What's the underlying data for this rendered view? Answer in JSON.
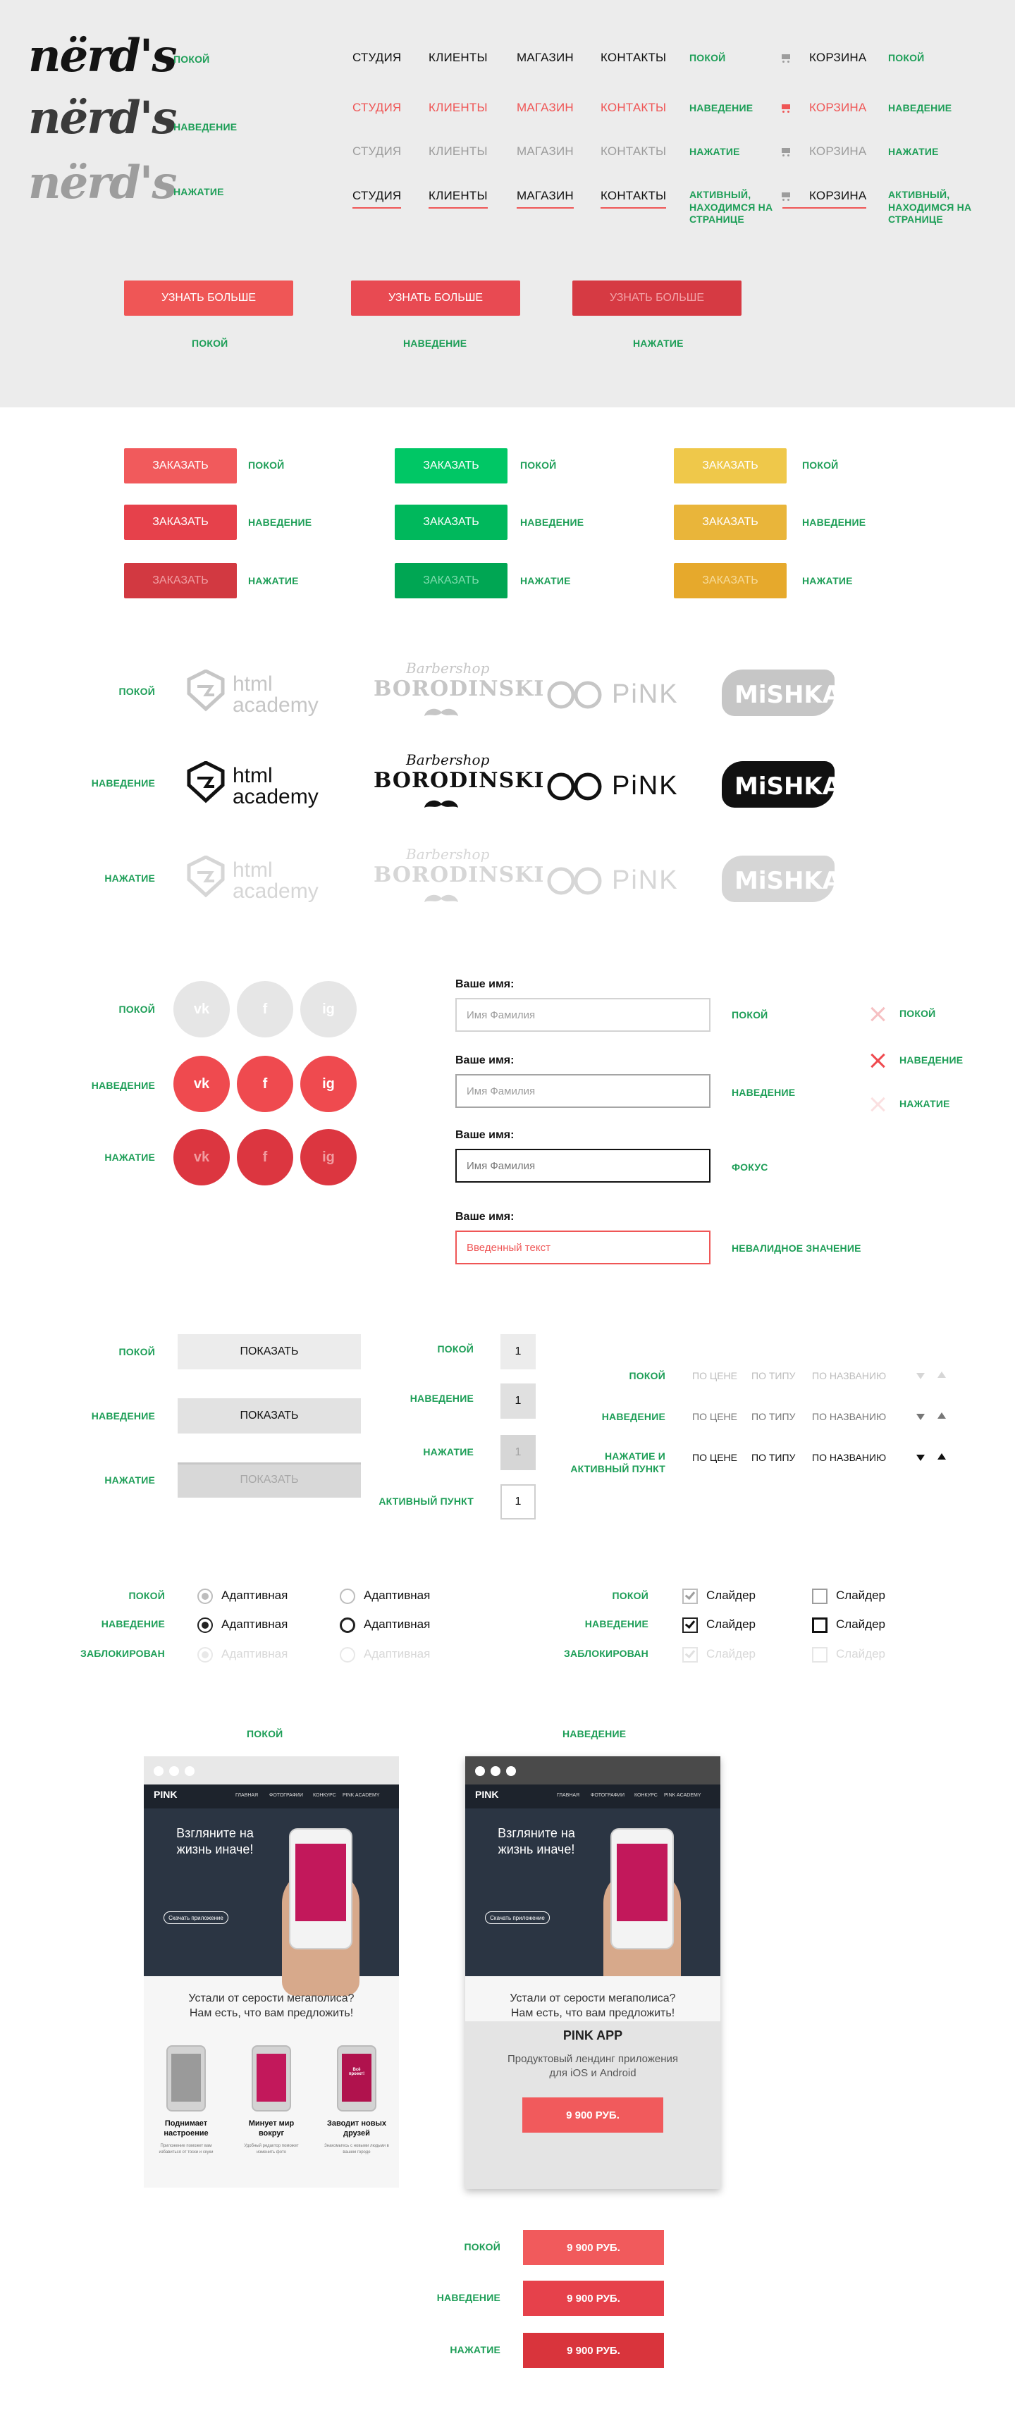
{
  "states": {
    "idle": "ПОКОЙ",
    "hover": "НАВЕДЕНИЕ",
    "press": "НАЖАТИЕ",
    "focus": "ФОКУС",
    "invalid": "НЕВАЛИДНОЕ ЗНАЧЕНИЕ",
    "active_page": "АКТИВНЫЙ, НАХОДИМСЯ НА СТРАНИЦЕ",
    "active_item": "АКТИВНЫЙ ПУНКТ",
    "hover_active": "НАЖАТИЕ И АКТИВНЫЙ ПУНКТ",
    "disabled": "ЗАБЛОКИРОВАН"
  },
  "logo": {
    "text": "nërd's"
  },
  "nav": {
    "items": [
      "СТУДИЯ",
      "КЛИЕНТЫ",
      "МАГАЗИН",
      "КОНТАКТЫ"
    ],
    "cart": "КОРЗИНА"
  },
  "more_button": {
    "label": "УЗНАТЬ БОЛЬШЕ"
  },
  "order_button": {
    "label": "ЗАКАЗАТЬ"
  },
  "partners": {
    "academy_line1": "html",
    "academy_line2": "academy",
    "barber_script": "Barbershop",
    "barber_name": "BORODINSKI",
    "pink": "PiNK",
    "mishka": "MiSHKA"
  },
  "social": {
    "vk": "vk",
    "fb": "f",
    "ig": "ig"
  },
  "form": {
    "label": "Ваше имя:",
    "placeholder": "Имя Фамилия",
    "invalid_value": "Введенный текст"
  },
  "show_button": {
    "label": "ПОКАЗАТЬ"
  },
  "pagination": {
    "page": "1"
  },
  "sort": {
    "price": "ПО ЦЕНЕ",
    "type": "ПО ТИПУ",
    "name": "ПО НАЗВАНИЮ"
  },
  "radio": {
    "label": "Адаптивная"
  },
  "checkbox": {
    "label": "Слайдер"
  },
  "mockup": {
    "logo": "PINK",
    "nav": [
      "Главная",
      "Фотографии",
      "Конкурс",
      "PINK Academy"
    ],
    "hero_title": "Взгляните на жизнь иначе!",
    "hero_button": "Скачать приложение",
    "subtitle": "Устали от серости мегаполиса? Нам есть, что вам предложить!",
    "subtitle_cut": "Устали от серости мегаполиса? Нам есть, что вам предложить!",
    "features": [
      {
        "title": "Поднимает настроение",
        "desc": "Приложение поможет вам избавиться от тоски и скуки"
      },
      {
        "title": "Минует мир вокруг",
        "desc": "Удобный редактор поможет изменить фото"
      },
      {
        "title": "Заводит новых друзей",
        "desc": "Знакомьтесь с новыми людьми в вашем городе"
      }
    ],
    "smile_text": "Всё проект!"
  },
  "product": {
    "title": "PINK APP",
    "desc": "Продуктовый лендинг приложения для iOS и Android",
    "price": "9 900 РУБ."
  }
}
